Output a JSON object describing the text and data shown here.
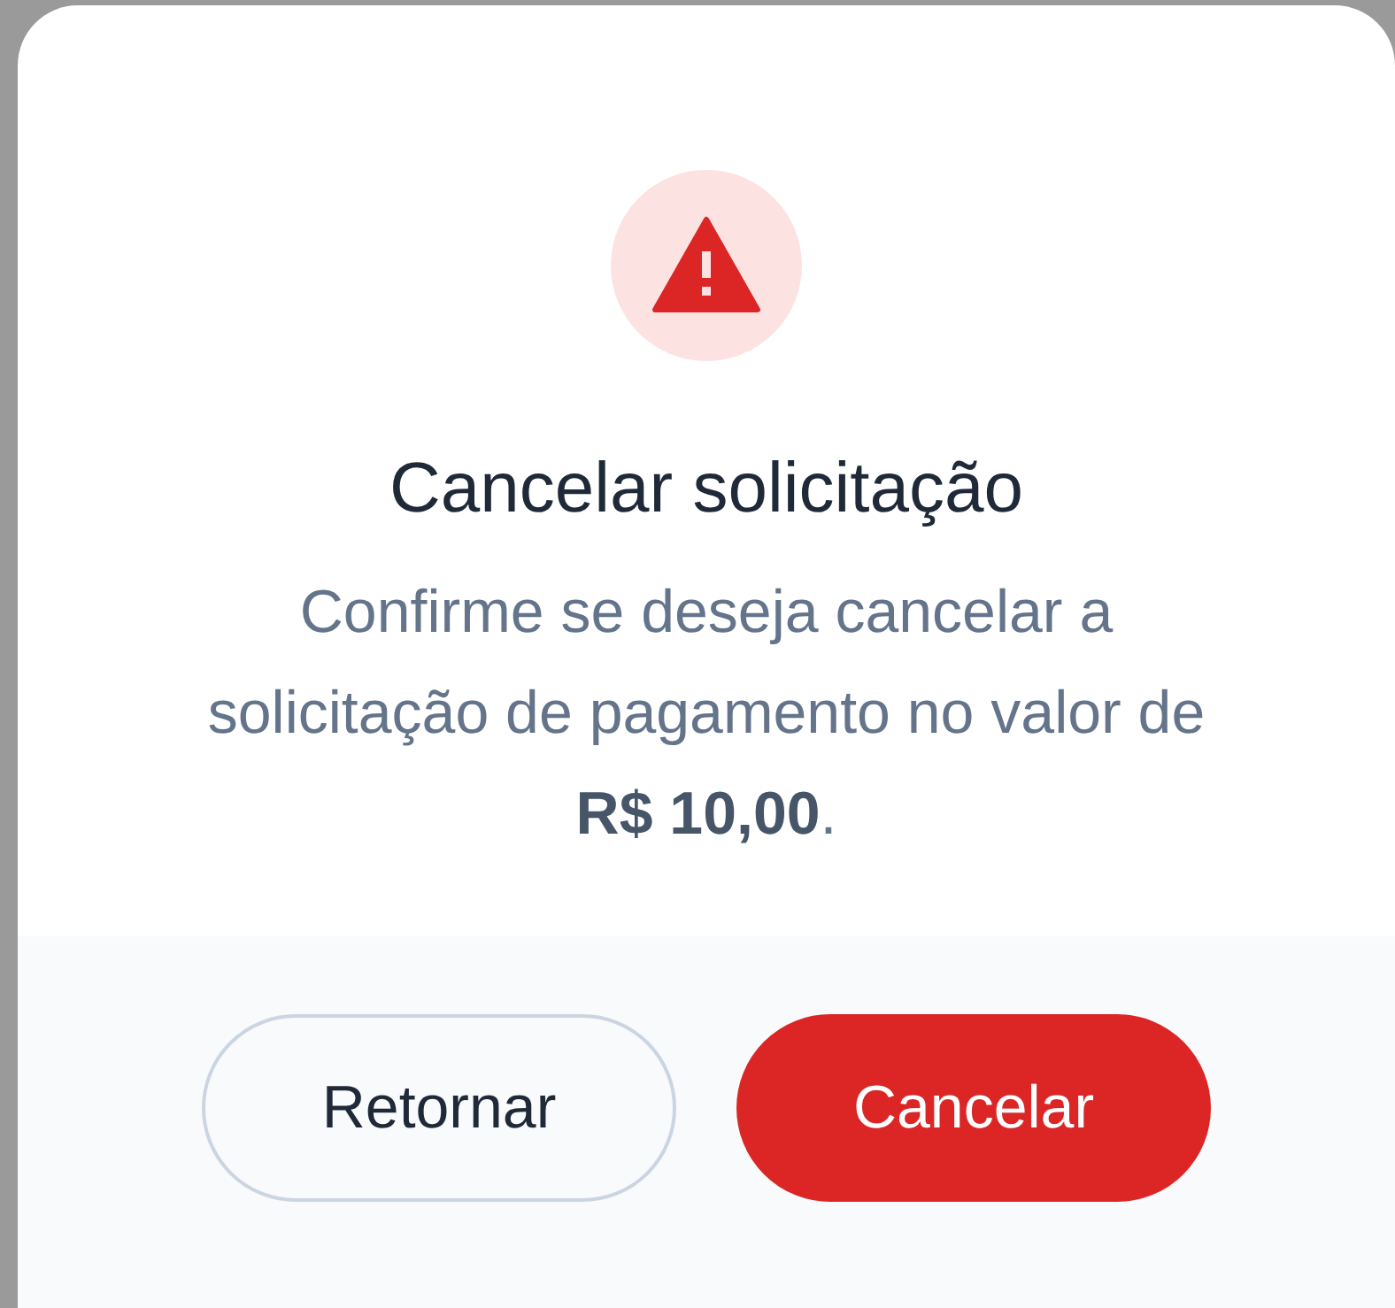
{
  "dialog": {
    "kind": "warning",
    "title": "Cancelar solicitação",
    "message": "Confirme se deseja cancelar a solicitação de pagamento no valor de **R$ 10,00**.",
    "buttons": [
      {
        "label": "Retornar",
        "kind": "secondary"
      },
      {
        "label": "Cancelar",
        "kind": "danger"
      }
    ]
  }
}
